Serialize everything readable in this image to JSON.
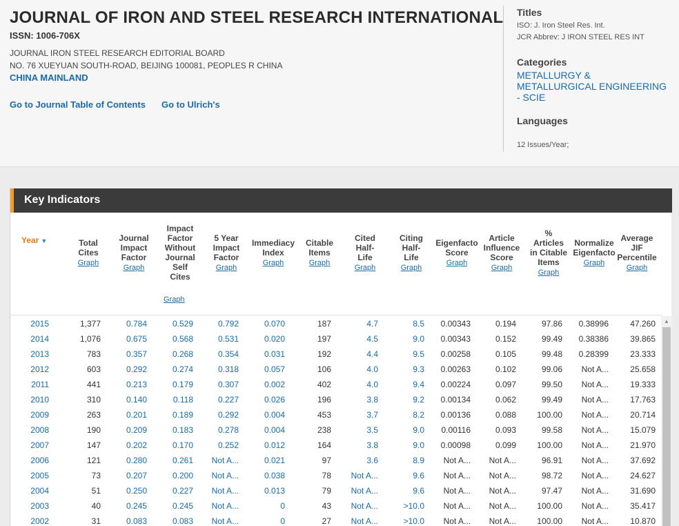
{
  "header": {
    "title": "JOURNAL OF IRON AND STEEL RESEARCH INTERNATIONAL",
    "issn": "ISSN: 1006-706X",
    "publisher": "JOURNAL IRON STEEL RESEARCH EDITORIAL BOARD",
    "address": "NO. 76 XUEYUAN SOUTH-ROAD, BEIJING 100081, PEOPLES R CHINA",
    "country": "CHINA MAINLAND",
    "links": {
      "toc": "Go to Journal Table of Contents",
      "ulrich": "Go to Ulrich's"
    }
  },
  "sidebar": {
    "titles_heading": "Titles",
    "iso": "ISO: J. Iron Steel Res. Int.",
    "jcr": "JCR Abbrev: J IRON STEEL RES INT",
    "categories_heading": "Categories",
    "category": "METALLURGY & METALLURGICAL ENGINEERING - SCIE",
    "languages_heading": "Languages",
    "frequency": "12 Issues/Year;"
  },
  "panel": {
    "title": "Key Indicators",
    "graph_label": "Graph",
    "columns": [
      {
        "key": "year",
        "label": "Year",
        "graph": false
      },
      {
        "key": "total_cites",
        "label": "Total\nCites",
        "graph": true
      },
      {
        "key": "jif",
        "label": "Journal\nImpact\nFactor",
        "graph": true
      },
      {
        "key": "if_wo_self",
        "label": "Impact\nFactor\nWithout\nJournal\nSelf\nCites",
        "graph": false
      },
      {
        "key": "five_year",
        "label": "5 Year\nImpact\nFactor",
        "graph": true
      },
      {
        "key": "immediacy",
        "label": "Immediacy\nIndex",
        "graph": true
      },
      {
        "key": "citable",
        "label": "Citable\nItems",
        "graph": true
      },
      {
        "key": "cited_hl",
        "label": "Cited\nHalf-\nLife",
        "graph": true
      },
      {
        "key": "citing_hl",
        "label": "Citing\nHalf-\nLife",
        "graph": true
      },
      {
        "key": "eigenfactor",
        "label": "Eigenfacto\nScore",
        "graph": true
      },
      {
        "key": "ais",
        "label": "Article\nInfluence\nScore",
        "graph": true
      },
      {
        "key": "pct_citable",
        "label": "%\nArticles\nin Citable\nItems",
        "graph": true
      },
      {
        "key": "norm_eigen",
        "label": "Normalize\nEigenfacto",
        "graph": true
      },
      {
        "key": "avg_jif_pct",
        "label": "Average\nJIF\nPercentile",
        "graph": true
      }
    ],
    "rows": [
      [
        "2015",
        "1,377",
        "0.784",
        "0.529",
        "0.792",
        "0.070",
        "187",
        "4.7",
        "8.5",
        "0.00343",
        "0.194",
        "97.86",
        "0.38996",
        "47.260"
      ],
      [
        "2014",
        "1,076",
        "0.675",
        "0.568",
        "0.531",
        "0.020",
        "197",
        "4.5",
        "9.0",
        "0.00343",
        "0.152",
        "99.49",
        "0.38386",
        "39.865"
      ],
      [
        "2013",
        "783",
        "0.357",
        "0.268",
        "0.354",
        "0.031",
        "192",
        "4.4",
        "9.5",
        "0.00258",
        "0.105",
        "99.48",
        "0.28399",
        "23.333"
      ],
      [
        "2012",
        "603",
        "0.292",
        "0.274",
        "0.318",
        "0.057",
        "106",
        "4.0",
        "9.3",
        "0.00263",
        "0.102",
        "99.06",
        "Not A...",
        "25.658"
      ],
      [
        "2011",
        "441",
        "0.213",
        "0.179",
        "0.307",
        "0.002",
        "402",
        "4.0",
        "9.4",
        "0.00224",
        "0.097",
        "99.50",
        "Not A...",
        "19.333"
      ],
      [
        "2010",
        "310",
        "0.140",
        "0.118",
        "0.227",
        "0.026",
        "196",
        "3.8",
        "9.2",
        "0.00134",
        "0.062",
        "99.49",
        "Not A...",
        "17.763"
      ],
      [
        "2009",
        "263",
        "0.201",
        "0.189",
        "0.292",
        "0.004",
        "453",
        "3.7",
        "8.2",
        "0.00136",
        "0.088",
        "100.00",
        "Not A...",
        "20.714"
      ],
      [
        "2008",
        "190",
        "0.209",
        "0.183",
        "0.278",
        "0.004",
        "238",
        "3.5",
        "9.0",
        "0.00116",
        "0.093",
        "99.58",
        "Not A...",
        "15.079"
      ],
      [
        "2007",
        "147",
        "0.202",
        "0.170",
        "0.252",
        "0.012",
        "164",
        "3.8",
        "9.0",
        "0.00098",
        "0.099",
        "100.00",
        "Not A...",
        "21.970"
      ],
      [
        "2006",
        "121",
        "0.280",
        "0.261",
        "Not A...",
        "0.021",
        "97",
        "3.6",
        "8.9",
        "Not A...",
        "Not A...",
        "96.91",
        "Not A...",
        "37.692"
      ],
      [
        "2005",
        "73",
        "0.207",
        "0.200",
        "Not A...",
        "0.038",
        "78",
        "Not A...",
        "9.6",
        "Not A...",
        "Not A...",
        "98.72",
        "Not A...",
        "24.627"
      ],
      [
        "2004",
        "51",
        "0.250",
        "0.227",
        "Not A...",
        "0.013",
        "79",
        "Not A...",
        "9.6",
        "Not A...",
        "Not A...",
        "97.47",
        "Not A...",
        "31.690"
      ],
      [
        "2003",
        "40",
        "0.245",
        "0.245",
        "Not A...",
        "0",
        "43",
        "Not A...",
        ">10.0",
        "Not A...",
        "Not A...",
        "100.00",
        "Not A...",
        "35.417"
      ],
      [
        "2002",
        "31",
        "0.083",
        "0.083",
        "Not A...",
        "0",
        "27",
        "Not A...",
        ">10.0",
        "Not A...",
        "Not A...",
        "100.00",
        "Not A...",
        "10.870"
      ]
    ]
  },
  "colors": {
    "accent_orange": "#f29d2a",
    "link_blue": "#1a6aa8",
    "panel_header": "#3b3b3b"
  },
  "icons": {
    "sort": "caret-down-icon",
    "scroll_up": "triangle-up-icon"
  }
}
